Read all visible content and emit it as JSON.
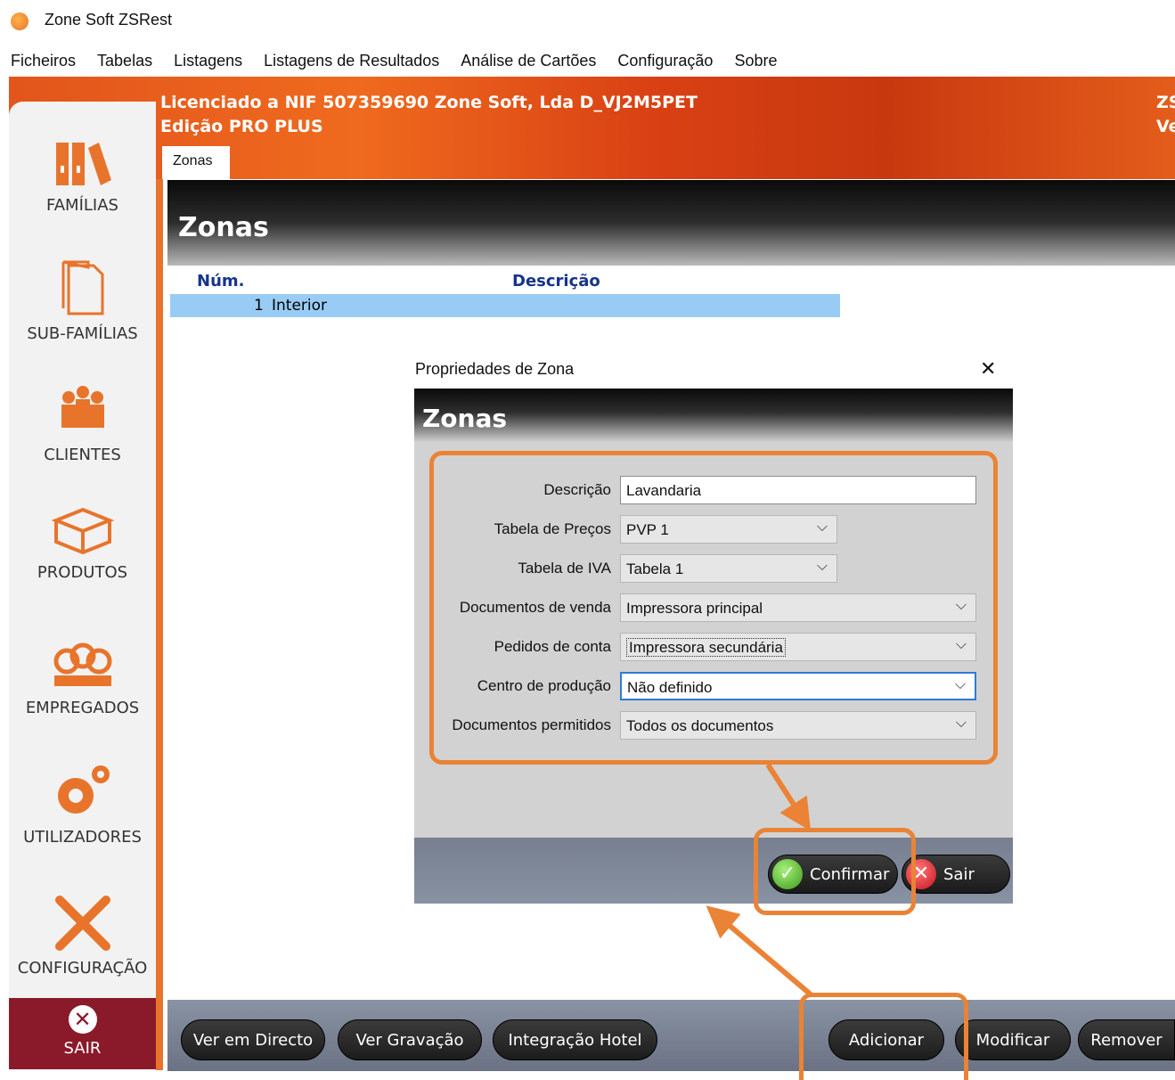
{
  "window": {
    "title": "Zone Soft ZSRest"
  },
  "menu": [
    "Ficheiros",
    "Tabelas",
    "Listagens",
    "Listagens de Resultados",
    "Análise de Cartões",
    "Configuração",
    "Sobre"
  ],
  "header": {
    "license": "Licenciado a NIF 507359690 Zone Soft, Lda D_VJ2M5PET",
    "edition": "Edição PRO PLUS",
    "right_line1": "ZS",
    "right_line2": "Ve",
    "active_tab": "Zonas"
  },
  "sidebar": {
    "items": [
      {
        "label": "FAMÍLIAS",
        "icon": "binders-icon"
      },
      {
        "label": "SUB-FAMÍLIAS",
        "icon": "pages-icon"
      },
      {
        "label": "CLIENTES",
        "icon": "people-icon"
      },
      {
        "label": "PRODUTOS",
        "icon": "box-icon"
      },
      {
        "label": "EMPREGADOS",
        "icon": "employees-icon"
      },
      {
        "label": "UTILIZADORES",
        "icon": "gears-icon"
      },
      {
        "label": "CONFIGURAÇÃO",
        "icon": "tools-icon"
      }
    ],
    "exit_label": "SAIR"
  },
  "main": {
    "title": "Zonas",
    "columns": [
      "Núm.",
      "Descrição"
    ],
    "rows": [
      {
        "num": "1",
        "desc": "Interior"
      }
    ]
  },
  "toolbar": {
    "live": "Ver em Directo",
    "recording": "Ver Gravação",
    "hotel": "Integração Hotel",
    "add": "Adicionar",
    "modify": "Modificar",
    "remove": "Remover"
  },
  "dialog": {
    "title": "Propriedades de Zona",
    "close": "✕",
    "header": "Zonas",
    "fields": {
      "descricao": {
        "label": "Descrição",
        "value": "Lavandaria"
      },
      "tabela_precos": {
        "label": "Tabela de Preços",
        "value": "PVP 1"
      },
      "tabela_iva": {
        "label": "Tabela de IVA",
        "value": "Tabela 1"
      },
      "docs_venda": {
        "label": "Documentos de venda",
        "value": "Impressora principal"
      },
      "pedidos_conta": {
        "label": "Pedidos de conta",
        "value": "Impressora secundária"
      },
      "centro_producao": {
        "label": "Centro de produção",
        "value": "Não definido"
      },
      "docs_permitidos": {
        "label": "Documentos permitidos",
        "value": "Todos os documentos"
      }
    },
    "confirm": "Confirmar",
    "exit": "Sair"
  },
  "colors": {
    "brand_orange": "#e2551c",
    "annotation_orange": "#ea8335",
    "selection_blue": "#99ccf5",
    "exit_red": "#8a1a2a"
  }
}
